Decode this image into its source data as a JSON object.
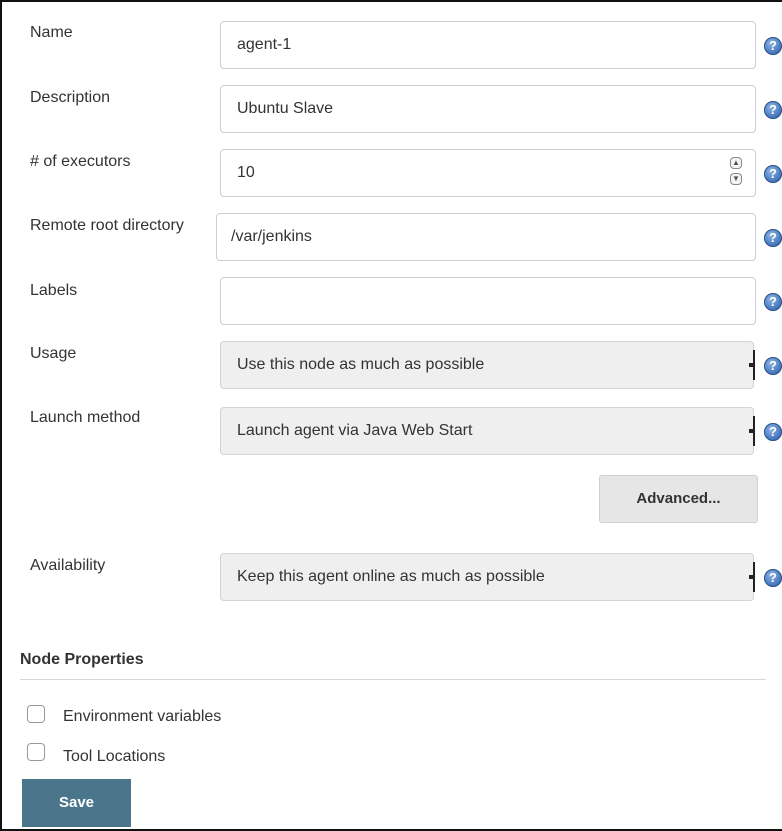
{
  "form": {
    "name": {
      "label": "Name",
      "value": "agent-1"
    },
    "description": {
      "label": "Description",
      "value": "Ubuntu Slave"
    },
    "executors": {
      "label": "# of executors",
      "value": "10"
    },
    "remote_root": {
      "label": "Remote root directory",
      "value": "/var/jenkins"
    },
    "labels": {
      "label": "Labels",
      "value": ""
    },
    "usage": {
      "label": "Usage",
      "selected": "Use this node as much as possible"
    },
    "launch_method": {
      "label": "Launch method",
      "selected": "Launch agent via Java Web Start"
    },
    "advanced_label": "Advanced...",
    "availability": {
      "label": "Availability",
      "selected": "Keep this agent online as much as possible"
    }
  },
  "help_icon_glyph": "?",
  "node_properties": {
    "title": "Node Properties",
    "options": [
      {
        "label": "Environment variables",
        "checked": false
      },
      {
        "label": "Tool Locations",
        "checked": false
      }
    ]
  },
  "save_label": "Save",
  "colors": {
    "save_button": "#4b758b",
    "help_icon": "#3d6fb6"
  }
}
